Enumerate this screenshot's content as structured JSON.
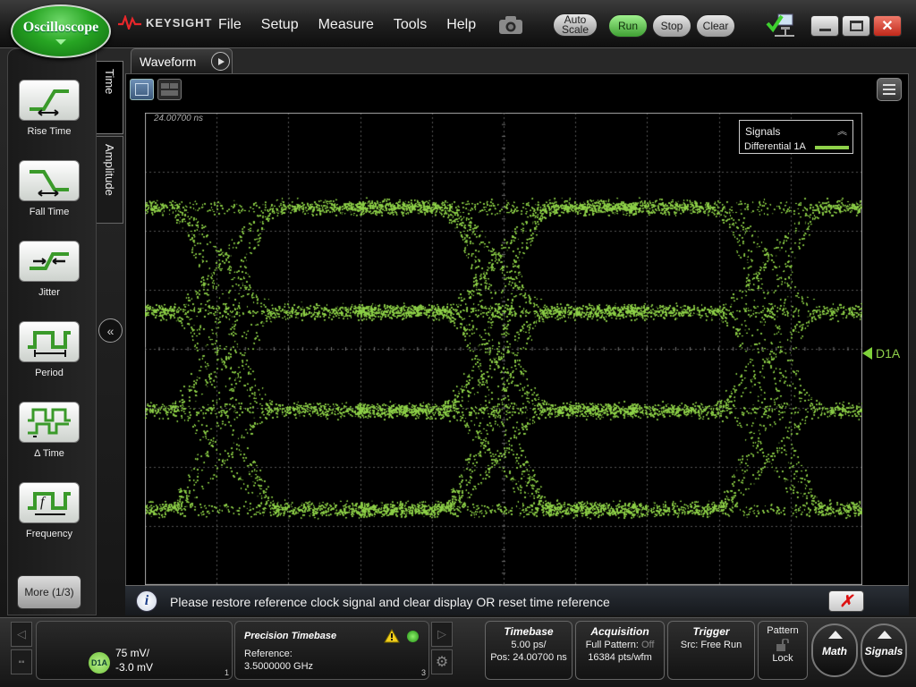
{
  "app": {
    "badge_title": "Oscilloscope",
    "brand": "KEYSIGHT",
    "menu": [
      "File",
      "Setup",
      "Measure",
      "Tools",
      "Help"
    ],
    "buttons": {
      "autoscale": "Auto Scale",
      "run": "Run",
      "stop": "Stop",
      "clear": "Clear"
    },
    "run_color": "#4caf3f"
  },
  "left_panel": {
    "tabs": [
      "Time",
      "Amplitude"
    ],
    "tools": [
      "Rise Time",
      "Fall Time",
      "Jitter",
      "Period",
      "Δ Time",
      "Frequency"
    ],
    "more": "More (1/3)"
  },
  "waveform": {
    "tab_label": "Waveform",
    "timestamp": "24.00700 ns",
    "legend_title": "Signals",
    "legend_series": "Differential 1A",
    "channel_marker": "D1A",
    "trace_color": "#8fd14a"
  },
  "message": {
    "text": "Please restore reference clock signal and clear display OR reset time reference"
  },
  "bottom": {
    "channel": {
      "tag": "D1A",
      "scale": "75 mV/",
      "offset": "-3.0 mV",
      "index": "1"
    },
    "precision": {
      "title": "Precision Timebase",
      "ref_label": "Reference:",
      "ref_value": "3.5000000 GHz",
      "index": "3"
    },
    "timebase": {
      "title": "Timebase",
      "scale": "5.00 ps/",
      "pos": "Pos: 24.00700 ns"
    },
    "acquisition": {
      "title": "Acquisition",
      "line1_label": "Full Pattern: ",
      "line1_value": "Off",
      "line2": "16384 pts/wfm"
    },
    "trigger": {
      "title": "Trigger",
      "src": "Src: Free Run"
    },
    "pattern": {
      "title": "Pattern",
      "lock": "Lock"
    },
    "math": "Math",
    "signals": "Signals"
  }
}
